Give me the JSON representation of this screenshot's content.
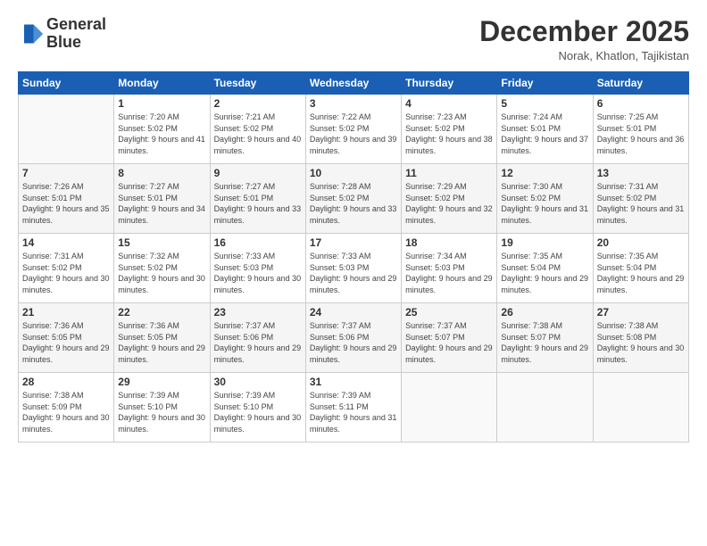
{
  "logo": {
    "line1": "General",
    "line2": "Blue"
  },
  "title": "December 2025",
  "location": "Norak, Khatlon, Tajikistan",
  "days_header": [
    "Sunday",
    "Monday",
    "Tuesday",
    "Wednesday",
    "Thursday",
    "Friday",
    "Saturday"
  ],
  "weeks": [
    [
      {
        "day": "",
        "sunrise": "",
        "sunset": "",
        "daylight": ""
      },
      {
        "day": "1",
        "sunrise": "Sunrise: 7:20 AM",
        "sunset": "Sunset: 5:02 PM",
        "daylight": "Daylight: 9 hours and 41 minutes."
      },
      {
        "day": "2",
        "sunrise": "Sunrise: 7:21 AM",
        "sunset": "Sunset: 5:02 PM",
        "daylight": "Daylight: 9 hours and 40 minutes."
      },
      {
        "day": "3",
        "sunrise": "Sunrise: 7:22 AM",
        "sunset": "Sunset: 5:02 PM",
        "daylight": "Daylight: 9 hours and 39 minutes."
      },
      {
        "day": "4",
        "sunrise": "Sunrise: 7:23 AM",
        "sunset": "Sunset: 5:02 PM",
        "daylight": "Daylight: 9 hours and 38 minutes."
      },
      {
        "day": "5",
        "sunrise": "Sunrise: 7:24 AM",
        "sunset": "Sunset: 5:01 PM",
        "daylight": "Daylight: 9 hours and 37 minutes."
      },
      {
        "day": "6",
        "sunrise": "Sunrise: 7:25 AM",
        "sunset": "Sunset: 5:01 PM",
        "daylight": "Daylight: 9 hours and 36 minutes."
      }
    ],
    [
      {
        "day": "7",
        "sunrise": "Sunrise: 7:26 AM",
        "sunset": "Sunset: 5:01 PM",
        "daylight": "Daylight: 9 hours and 35 minutes."
      },
      {
        "day": "8",
        "sunrise": "Sunrise: 7:27 AM",
        "sunset": "Sunset: 5:01 PM",
        "daylight": "Daylight: 9 hours and 34 minutes."
      },
      {
        "day": "9",
        "sunrise": "Sunrise: 7:27 AM",
        "sunset": "Sunset: 5:01 PM",
        "daylight": "Daylight: 9 hours and 33 minutes."
      },
      {
        "day": "10",
        "sunrise": "Sunrise: 7:28 AM",
        "sunset": "Sunset: 5:02 PM",
        "daylight": "Daylight: 9 hours and 33 minutes."
      },
      {
        "day": "11",
        "sunrise": "Sunrise: 7:29 AM",
        "sunset": "Sunset: 5:02 PM",
        "daylight": "Daylight: 9 hours and 32 minutes."
      },
      {
        "day": "12",
        "sunrise": "Sunrise: 7:30 AM",
        "sunset": "Sunset: 5:02 PM",
        "daylight": "Daylight: 9 hours and 31 minutes."
      },
      {
        "day": "13",
        "sunrise": "Sunrise: 7:31 AM",
        "sunset": "Sunset: 5:02 PM",
        "daylight": "Daylight: 9 hours and 31 minutes."
      }
    ],
    [
      {
        "day": "14",
        "sunrise": "Sunrise: 7:31 AM",
        "sunset": "Sunset: 5:02 PM",
        "daylight": "Daylight: 9 hours and 30 minutes."
      },
      {
        "day": "15",
        "sunrise": "Sunrise: 7:32 AM",
        "sunset": "Sunset: 5:02 PM",
        "daylight": "Daylight: 9 hours and 30 minutes."
      },
      {
        "day": "16",
        "sunrise": "Sunrise: 7:33 AM",
        "sunset": "Sunset: 5:03 PM",
        "daylight": "Daylight: 9 hours and 30 minutes."
      },
      {
        "day": "17",
        "sunrise": "Sunrise: 7:33 AM",
        "sunset": "Sunset: 5:03 PM",
        "daylight": "Daylight: 9 hours and 29 minutes."
      },
      {
        "day": "18",
        "sunrise": "Sunrise: 7:34 AM",
        "sunset": "Sunset: 5:03 PM",
        "daylight": "Daylight: 9 hours and 29 minutes."
      },
      {
        "day": "19",
        "sunrise": "Sunrise: 7:35 AM",
        "sunset": "Sunset: 5:04 PM",
        "daylight": "Daylight: 9 hours and 29 minutes."
      },
      {
        "day": "20",
        "sunrise": "Sunrise: 7:35 AM",
        "sunset": "Sunset: 5:04 PM",
        "daylight": "Daylight: 9 hours and 29 minutes."
      }
    ],
    [
      {
        "day": "21",
        "sunrise": "Sunrise: 7:36 AM",
        "sunset": "Sunset: 5:05 PM",
        "daylight": "Daylight: 9 hours and 29 minutes."
      },
      {
        "day": "22",
        "sunrise": "Sunrise: 7:36 AM",
        "sunset": "Sunset: 5:05 PM",
        "daylight": "Daylight: 9 hours and 29 minutes."
      },
      {
        "day": "23",
        "sunrise": "Sunrise: 7:37 AM",
        "sunset": "Sunset: 5:06 PM",
        "daylight": "Daylight: 9 hours and 29 minutes."
      },
      {
        "day": "24",
        "sunrise": "Sunrise: 7:37 AM",
        "sunset": "Sunset: 5:06 PM",
        "daylight": "Daylight: 9 hours and 29 minutes."
      },
      {
        "day": "25",
        "sunrise": "Sunrise: 7:37 AM",
        "sunset": "Sunset: 5:07 PM",
        "daylight": "Daylight: 9 hours and 29 minutes."
      },
      {
        "day": "26",
        "sunrise": "Sunrise: 7:38 AM",
        "sunset": "Sunset: 5:07 PM",
        "daylight": "Daylight: 9 hours and 29 minutes."
      },
      {
        "day": "27",
        "sunrise": "Sunrise: 7:38 AM",
        "sunset": "Sunset: 5:08 PM",
        "daylight": "Daylight: 9 hours and 30 minutes."
      }
    ],
    [
      {
        "day": "28",
        "sunrise": "Sunrise: 7:38 AM",
        "sunset": "Sunset: 5:09 PM",
        "daylight": "Daylight: 9 hours and 30 minutes."
      },
      {
        "day": "29",
        "sunrise": "Sunrise: 7:39 AM",
        "sunset": "Sunset: 5:10 PM",
        "daylight": "Daylight: 9 hours and 30 minutes."
      },
      {
        "day": "30",
        "sunrise": "Sunrise: 7:39 AM",
        "sunset": "Sunset: 5:10 PM",
        "daylight": "Daylight: 9 hours and 30 minutes."
      },
      {
        "day": "31",
        "sunrise": "Sunrise: 7:39 AM",
        "sunset": "Sunset: 5:11 PM",
        "daylight": "Daylight: 9 hours and 31 minutes."
      },
      {
        "day": "",
        "sunrise": "",
        "sunset": "",
        "daylight": ""
      },
      {
        "day": "",
        "sunrise": "",
        "sunset": "",
        "daylight": ""
      },
      {
        "day": "",
        "sunrise": "",
        "sunset": "",
        "daylight": ""
      }
    ]
  ]
}
